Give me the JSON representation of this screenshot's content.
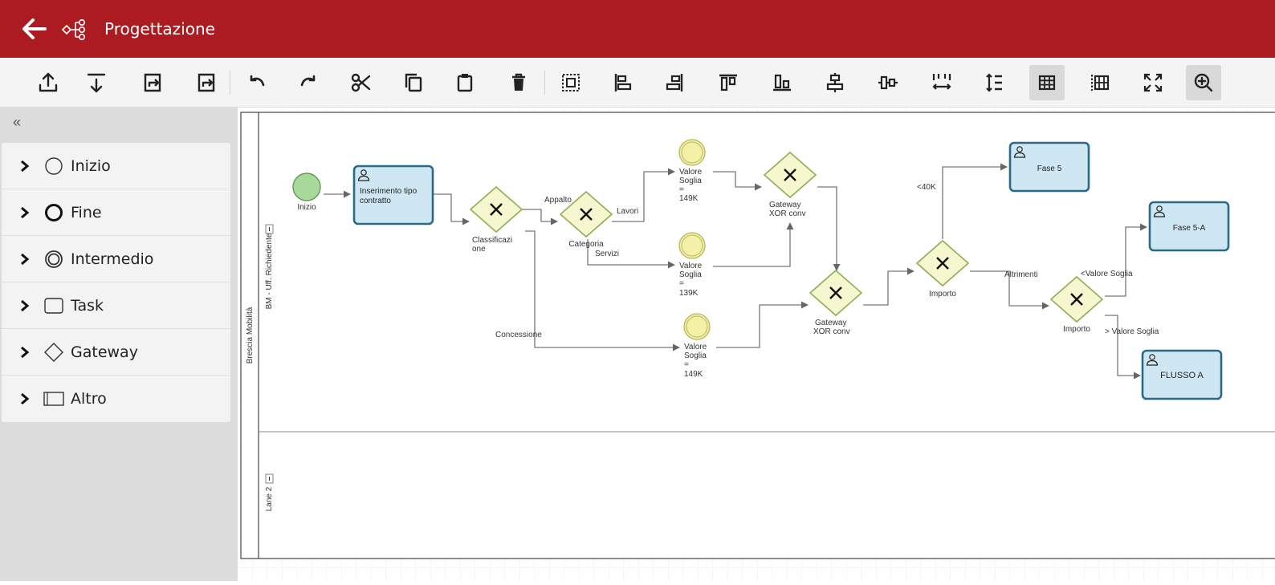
{
  "header": {
    "title": "Progettazione"
  },
  "sidebar": {
    "collapse_label": "«",
    "items": [
      {
        "label": "Inizio",
        "icon": "circle-thin-icon"
      },
      {
        "label": "Fine",
        "icon": "circle-thick-icon"
      },
      {
        "label": "Intermedio",
        "icon": "circle-double-icon"
      },
      {
        "label": "Task",
        "icon": "rounded-rect-icon"
      },
      {
        "label": "Gateway",
        "icon": "diamond-icon"
      },
      {
        "label": "Altro",
        "icon": "rect-icon"
      }
    ]
  },
  "diagram": {
    "pool": "Brescia Mobilità",
    "lane1": "BM - Uff. Richiedente",
    "lane2": "Lane 2",
    "start": "Inizio",
    "task_inserimento_1": "Inserimento tipo",
    "task_inserimento_2": "contratto",
    "gw_class_1": "Classificazi",
    "gw_class_2": "one",
    "gw_cat": "Categoria",
    "flow_appalto": "Appalto",
    "flow_lavori": "Lavori",
    "flow_servizi": "Servizi",
    "flow_concessione": "Concessione",
    "ev1": [
      "Valore",
      "Soglia",
      "=",
      "149K"
    ],
    "ev2": [
      "Valore",
      "Soglia",
      "=",
      "139K"
    ],
    "ev3": [
      "Valore",
      "Soglia",
      "=",
      "149K"
    ],
    "gw_xor1": [
      "Gateway",
      "XOR conv"
    ],
    "gw_xor2": [
      "Gateway",
      "XOR conv"
    ],
    "gw_importo1": "Importo",
    "gw_importo2": "Importo",
    "flow_lt40k": "<40K",
    "flow_altrimenti": "Altrimenti",
    "flow_lt_valore": "<Valore Soglia",
    "flow_gt_valore": "> Valore Soglia",
    "task_fase5": "Fase 5",
    "task_fase5a": "Fase 5-A",
    "task_flusso": "FLUSSO A"
  },
  "colors": {
    "header": "#ad1b22",
    "task_fill": "#cfe7f2",
    "task_stroke": "#2a6a86",
    "gateway_fill": "#f6f7cf",
    "gateway_stroke": "#8fae55",
    "start_fill": "#a9d99a",
    "intermediate_fill": "#f3f0a8"
  }
}
